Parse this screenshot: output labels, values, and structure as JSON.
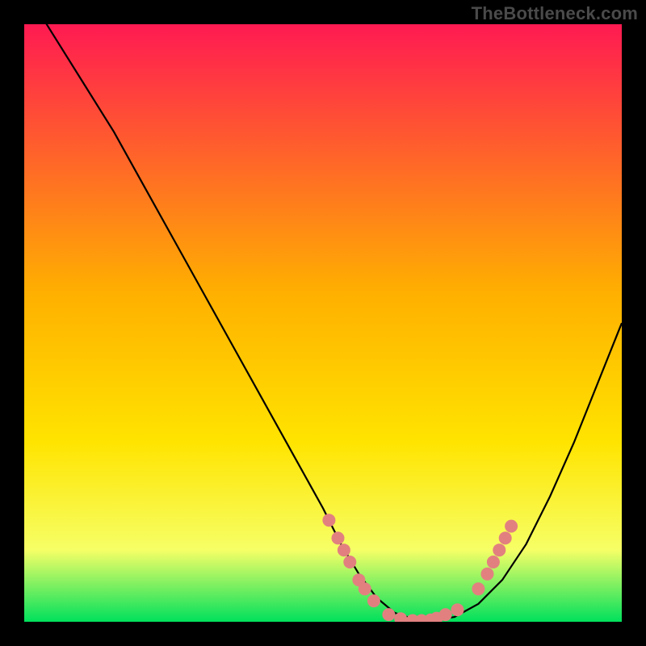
{
  "watermark": "TheBottleneck.com",
  "colors": {
    "frame": "#000000",
    "gradient_top": "#ff1a52",
    "gradient_mid": "#ffd400",
    "gradient_low": "#f6ff66",
    "gradient_bottom": "#00e05c",
    "curve": "#000000",
    "marker": "#e28080"
  },
  "chart_data": {
    "type": "line",
    "title": "",
    "xlabel": "",
    "ylabel": "",
    "xlim": [
      0,
      100
    ],
    "ylim": [
      0,
      100
    ],
    "series": [
      {
        "name": "bottleneck-curve",
        "x": [
          0,
          5,
          10,
          15,
          20,
          25,
          30,
          35,
          40,
          45,
          50,
          53,
          56,
          59,
          62,
          65,
          68,
          72,
          76,
          80,
          84,
          88,
          92,
          96,
          100
        ],
        "y": [
          106,
          98,
          90,
          82,
          73,
          64,
          55,
          46,
          37,
          28,
          19,
          13,
          8,
          4,
          1.5,
          0.5,
          0.2,
          0.8,
          3,
          7,
          13,
          21,
          30,
          40,
          50
        ]
      }
    ],
    "markers": [
      {
        "name": "trough-cluster",
        "color": "#e28080",
        "radius": 8,
        "points": [
          {
            "x": 51,
            "y": 17
          },
          {
            "x": 52.5,
            "y": 14
          },
          {
            "x": 53.5,
            "y": 12
          },
          {
            "x": 54.5,
            "y": 10
          },
          {
            "x": 56,
            "y": 7
          },
          {
            "x": 57,
            "y": 5.5
          },
          {
            "x": 58.5,
            "y": 3.5
          },
          {
            "x": 61,
            "y": 1.2
          },
          {
            "x": 63,
            "y": 0.5
          },
          {
            "x": 65,
            "y": 0.2
          },
          {
            "x": 66.5,
            "y": 0.2
          },
          {
            "x": 68,
            "y": 0.3
          },
          {
            "x": 69,
            "y": 0.6
          },
          {
            "x": 70.5,
            "y": 1.2
          },
          {
            "x": 72.5,
            "y": 2
          },
          {
            "x": 76,
            "y": 5.5
          },
          {
            "x": 77.5,
            "y": 8
          },
          {
            "x": 78.5,
            "y": 10
          },
          {
            "x": 79.5,
            "y": 12
          },
          {
            "x": 80.5,
            "y": 14
          },
          {
            "x": 81.5,
            "y": 16
          }
        ]
      }
    ]
  }
}
